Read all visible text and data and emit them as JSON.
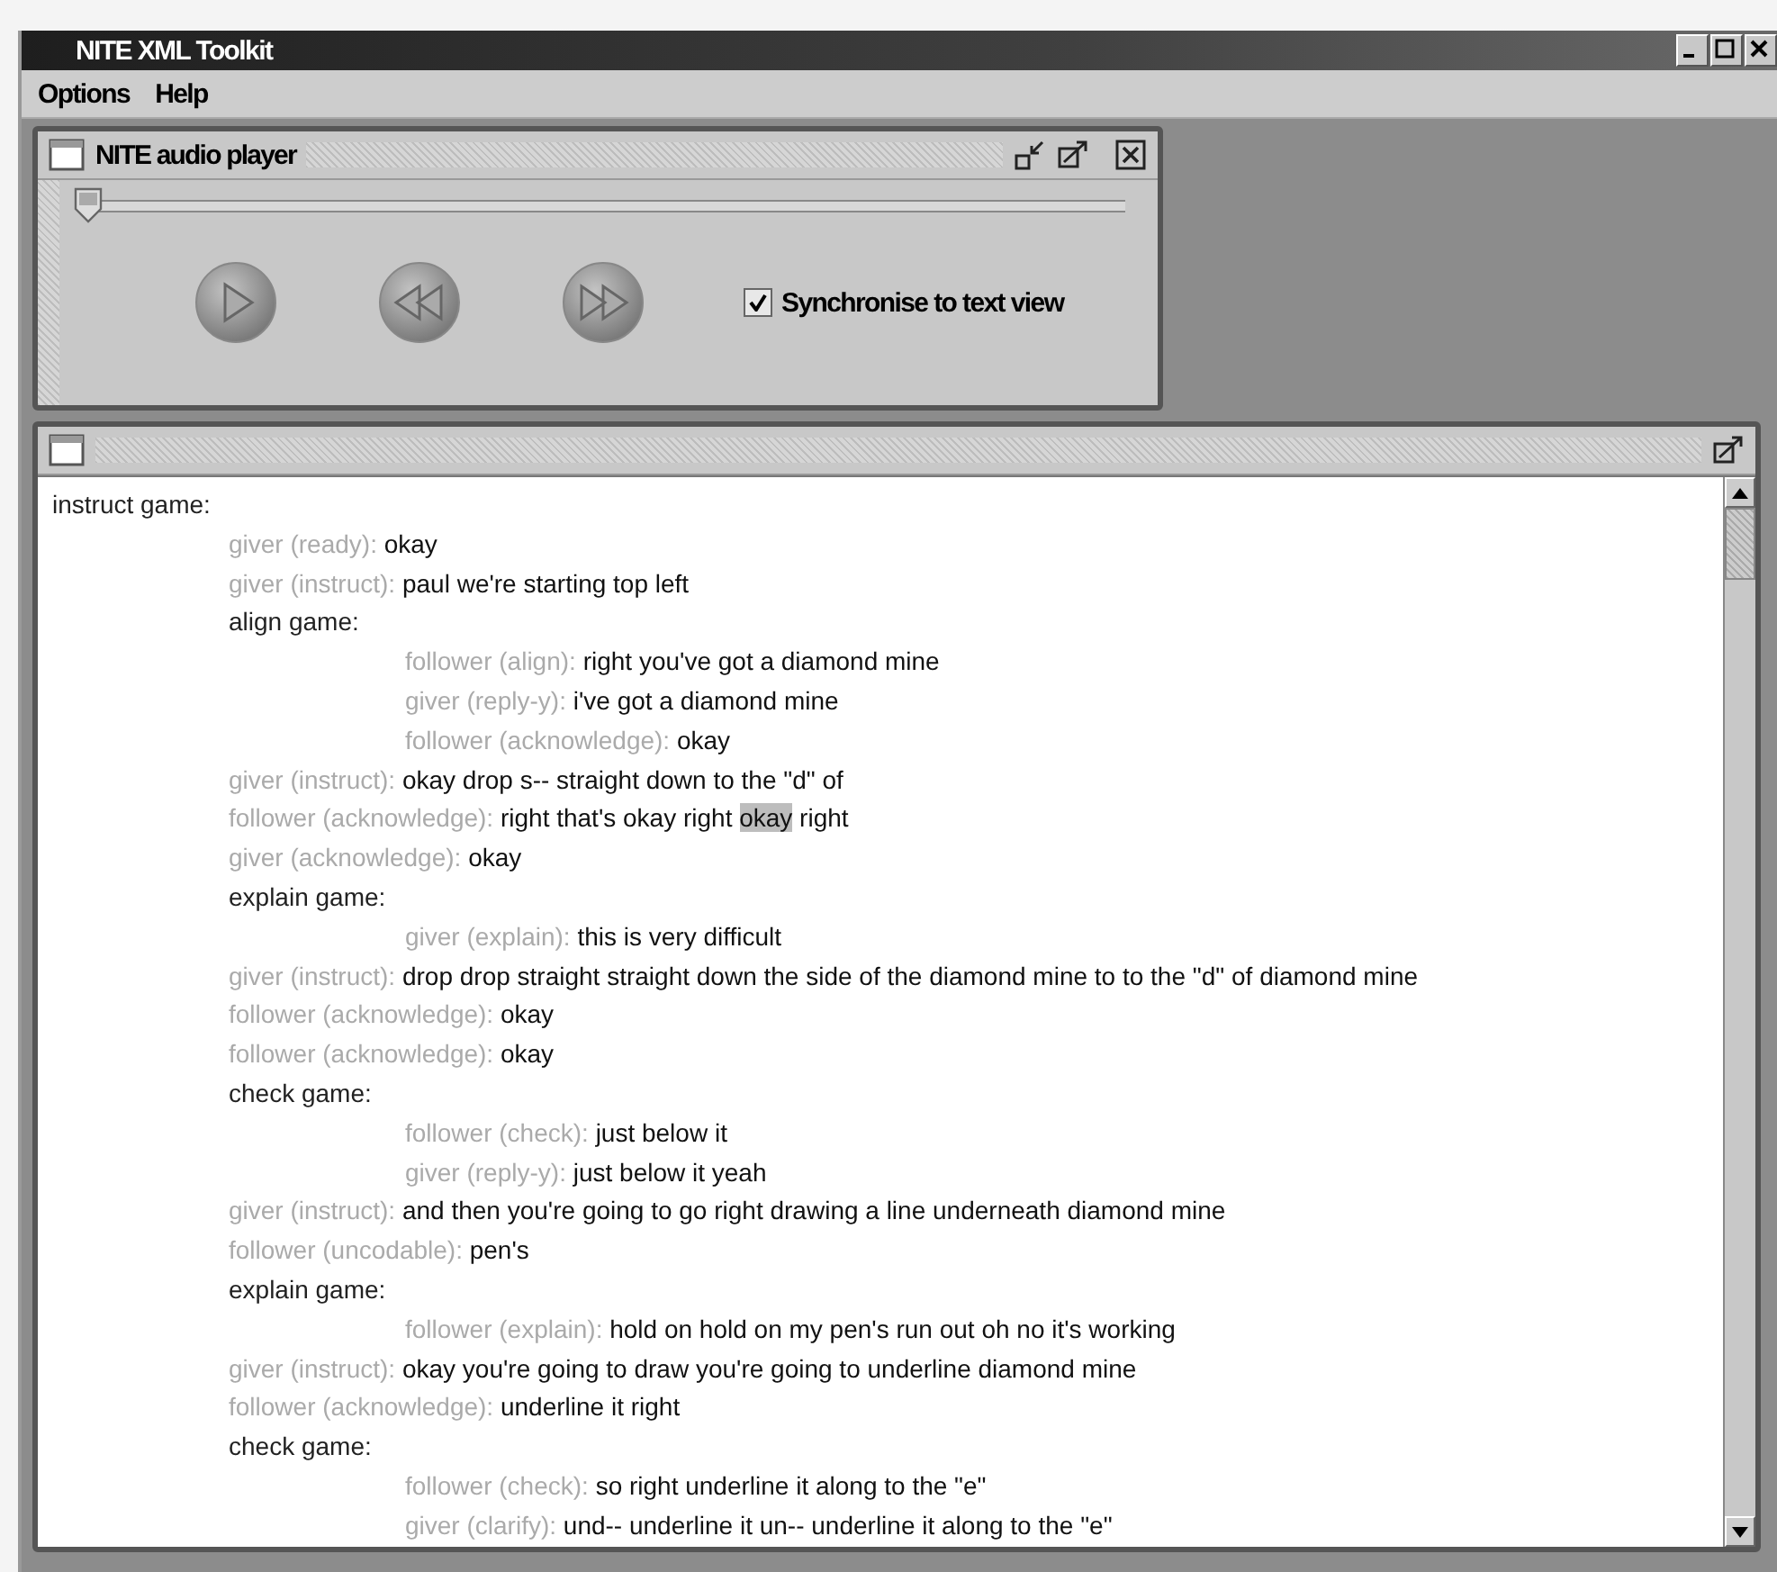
{
  "window": {
    "title": "NITE XML Toolkit"
  },
  "menu": [
    {
      "label": "Options"
    },
    {
      "label": "Help"
    }
  ],
  "audio_player": {
    "title": "NITE audio player",
    "position": {
      "level": 0.0
    },
    "synchronise": {
      "label": "Synchronise to text view",
      "checked": true
    }
  },
  "text_view": {
    "transcript": [
      {
        "kind": "game",
        "label": "instruct game:",
        "children": [
          {
            "kind": "move",
            "speaker": "giver (ready):",
            "text": "okay"
          },
          {
            "kind": "move",
            "speaker": "giver (instruct):",
            "text": "paul we're starting top left"
          },
          {
            "kind": "game",
            "label": "align game:",
            "children": [
              {
                "kind": "move",
                "speaker": "follower (align):",
                "text": "right you've got a diamond mine"
              },
              {
                "kind": "move",
                "speaker": "giver (reply-y):",
                "text": "i've got a diamond mine"
              },
              {
                "kind": "move",
                "speaker": "follower (acknowledge):",
                "text": "okay"
              }
            ]
          },
          {
            "kind": "move",
            "speaker": "giver (instruct):",
            "text": "okay drop s-- straight down to the \"d\" of"
          },
          {
            "kind": "move",
            "speaker": "follower (acknowledge):",
            "segments": [
              {
                "text": "right that's okay right ",
                "selected": false
              },
              {
                "text": "okay",
                "selected": true
              },
              {
                "text": " right",
                "selected": false
              }
            ]
          },
          {
            "kind": "move",
            "speaker": "giver (acknowledge):",
            "text": "okay"
          },
          {
            "kind": "game",
            "label": "explain game:",
            "children": [
              {
                "kind": "move",
                "speaker": "giver (explain):",
                "text": "this is very difficult"
              }
            ]
          },
          {
            "kind": "move",
            "speaker": "giver (instruct):",
            "text": "drop drop straight straight down the side of the diamond mine to to the \"d\" of diamond mine"
          },
          {
            "kind": "move",
            "speaker": "follower (acknowledge):",
            "text": "okay"
          },
          {
            "kind": "move",
            "speaker": "follower (acknowledge):",
            "text": "okay"
          },
          {
            "kind": "game",
            "label": "check game:",
            "children": [
              {
                "kind": "move",
                "speaker": "follower (check):",
                "text": "just below it"
              },
              {
                "kind": "move",
                "speaker": "giver (reply-y):",
                "text": "just below it yeah"
              }
            ]
          },
          {
            "kind": "move",
            "speaker": "giver (instruct):",
            "text": "and then you're going to go right drawing a line underneath diamond mine"
          },
          {
            "kind": "move",
            "speaker": "follower (uncodable):",
            "text": "pen's"
          },
          {
            "kind": "game",
            "label": "explain game:",
            "children": [
              {
                "kind": "move",
                "speaker": "follower (explain):",
                "text": "hold on hold on my pen's run out oh no it's working"
              }
            ]
          },
          {
            "kind": "move",
            "speaker": "giver (instruct):",
            "text": "okay you're going to draw you're going to underline diamond mine"
          },
          {
            "kind": "move",
            "speaker": "follower (acknowledge):",
            "text": "underline it right"
          },
          {
            "kind": "game",
            "label": "check game:",
            "children": [
              {
                "kind": "move",
                "speaker": "follower (check):",
                "text": "so right underline it along to the \"e\""
              },
              {
                "kind": "move",
                "speaker": "giver (clarify):",
                "text": "und-- underline it un-- underline it along to the \"e\""
              }
            ]
          }
        ]
      }
    ]
  }
}
